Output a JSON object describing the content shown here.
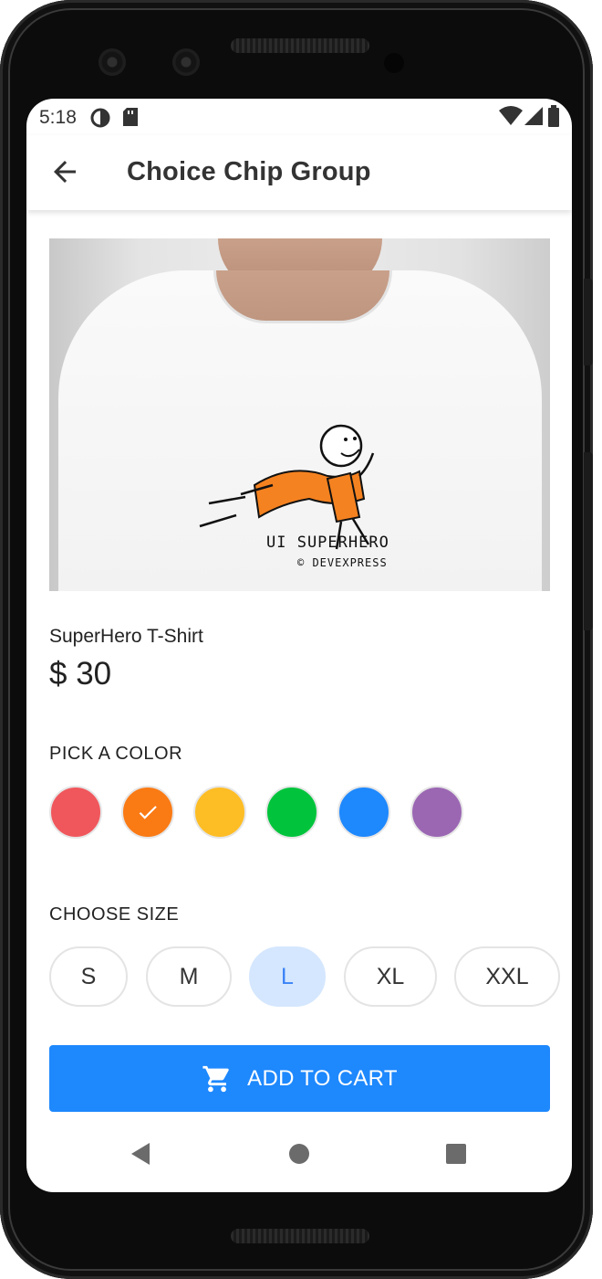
{
  "status_bar": {
    "time": "5:18",
    "icons": [
      "data-saver-icon",
      "sd-card-icon",
      "wifi-icon",
      "cell-signal-icon",
      "battery-icon"
    ]
  },
  "app_bar": {
    "back_icon": "arrow-left-icon",
    "title": "Choice Chip Group"
  },
  "product": {
    "image_text_line1": "UI SUPERHERO",
    "image_text_line2": "© DEVEXPRESS",
    "name": "SuperHero T-Shirt",
    "price": "$ 30"
  },
  "color_section": {
    "label": "PICK A COLOR",
    "colors": [
      {
        "hex": "#f0575c",
        "selected": false
      },
      {
        "hex": "#fa7a14",
        "selected": true
      },
      {
        "hex": "#fdbd24",
        "selected": false
      },
      {
        "hex": "#01c43c",
        "selected": false
      },
      {
        "hex": "#1e88fd",
        "selected": false
      },
      {
        "hex": "#9b67b3",
        "selected": false
      }
    ],
    "selected_icon": "check-icon"
  },
  "size_section": {
    "label": "CHOOSE SIZE",
    "sizes": [
      {
        "label": "S",
        "selected": false
      },
      {
        "label": "M",
        "selected": false
      },
      {
        "label": "L",
        "selected": true
      },
      {
        "label": "XL",
        "selected": false
      },
      {
        "label": "XXL",
        "selected": false
      }
    ]
  },
  "cart_button": {
    "icon": "cart-icon",
    "label": "ADD TO CART"
  },
  "nav_bar": {
    "icons": [
      "back-triangle-icon",
      "home-circle-icon",
      "recents-square-icon"
    ]
  },
  "colors": {
    "accent": "#1e88fd",
    "chip_selected_bg": "#d5e7fe",
    "chip_selected_text": "#3b82f6"
  }
}
